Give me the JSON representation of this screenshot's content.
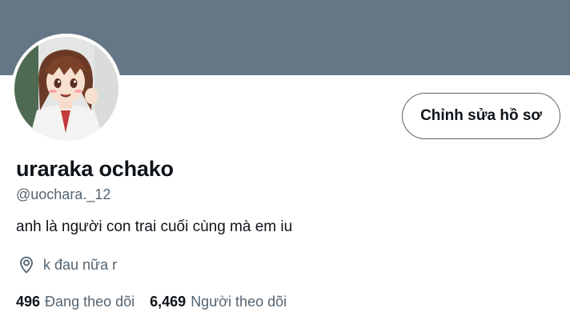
{
  "profile": {
    "banner_color": "#657786",
    "avatar_icon": "avatar-anime-girl",
    "display_name": "uraraka ochako",
    "handle": "@uochara._12",
    "bio": "anh là người con trai cuối cùng mà em iu",
    "location_icon": "location-pin-icon",
    "location": "k đau nữa r"
  },
  "actions": {
    "edit_profile_label": "Chỉnh sửa hồ sơ"
  },
  "stats": {
    "following_count": "496",
    "following_label": "Đang theo dõi",
    "followers_count": "6,469",
    "followers_label": "Người theo dõi"
  },
  "colors": {
    "text_primary": "#0f1419",
    "text_secondary": "#536471",
    "button_border": "#536471"
  }
}
